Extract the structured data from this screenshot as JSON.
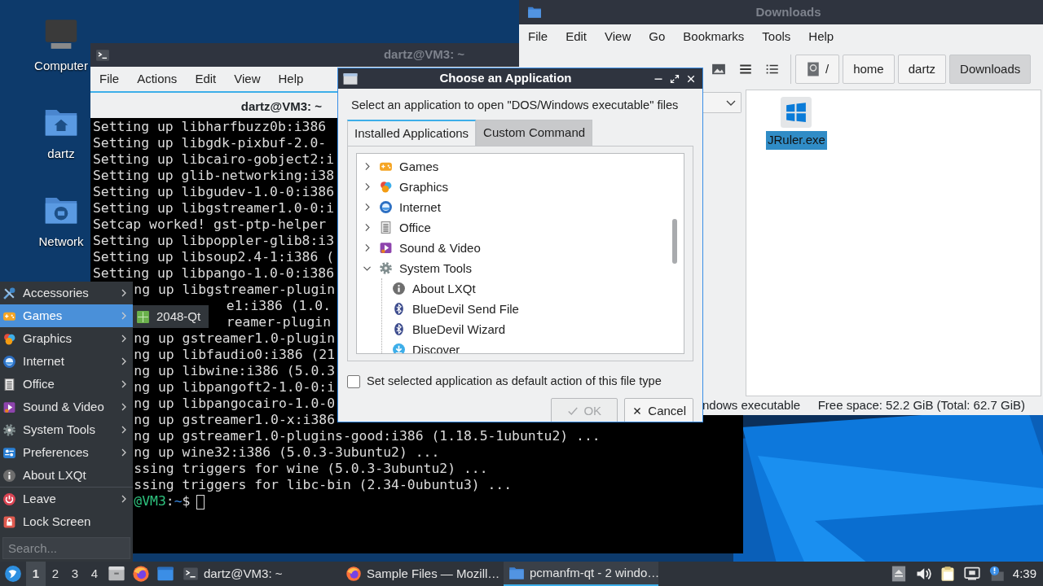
{
  "desktop_icons": [
    {
      "label": "Computer",
      "kind": "computer"
    },
    {
      "label": "dartz",
      "kind": "home"
    },
    {
      "label": "Network",
      "kind": "network"
    }
  ],
  "terminal": {
    "title": "dartz@VM3: ~",
    "menu": [
      "File",
      "Actions",
      "Edit",
      "View",
      "Help"
    ],
    "tab": "dartz@VM3: ~",
    "lines": [
      {
        "text": "Setting up libharfbuzz0b:i386",
        "kind": "line"
      },
      {
        "text": "Setting up libgdk-pixbuf-2.0-",
        "kind": "line"
      },
      {
        "text": "Setting up libcairo-gobject2:i",
        "kind": "line"
      },
      {
        "text": "Setting up glib-networking:i38",
        "kind": "line"
      },
      {
        "text": "Setting up libgudev-1.0-0:i386",
        "kind": "line"
      },
      {
        "text": "Setting up libgstreamer1.0-0:i",
        "kind": "line"
      },
      {
        "text": "Setcap worked! gst-ptp-helper",
        "kind": "line"
      },
      {
        "text": "Setting up libpoppler-glib8:i3",
        "kind": "line"
      },
      {
        "text": "Setting up libsoup2.4-1:i386 (",
        "kind": "line"
      },
      {
        "text": "Setting up libpango-1.0-0:i386",
        "kind": "line"
      },
      {
        "text": "ng up libgstreamer-plugin",
        "kind": "after-menu"
      },
      {
        "text": "e1:i386 (1.0.",
        "kind": "after-submenu"
      },
      {
        "text": "reamer-plugin",
        "kind": "after-submenu"
      },
      {
        "text": "ng up gstreamer1.0-plugin",
        "kind": "after-menu"
      },
      {
        "text": "ng up libfaudio0:i386 (21",
        "kind": "after-menu"
      },
      {
        "text": "ng up libwine:i386 (5.0.3",
        "kind": "after-menu"
      },
      {
        "text": "ng up libpangoft2-1.0-0:i",
        "kind": "after-menu"
      },
      {
        "text": "ng up libpangocairo-1.0-0",
        "kind": "after-menu"
      },
      {
        "text": "ng up gstreamer1.0-x:i386",
        "kind": "after-menu"
      },
      {
        "text": "ng up gstreamer1.0-plugins-good:i386 (1.18.5-1ubuntu2) ...",
        "kind": "after-menu"
      },
      {
        "text": "ng up wine32:i386 (5.0.3-3ubuntu2) ...",
        "kind": "after-menu"
      },
      {
        "text": "ssing triggers for wine (5.0.3-3ubuntu2) ...",
        "kind": "after-menu"
      },
      {
        "text": "ssing triggers for libc-bin (2.34-0ubuntu3) ...",
        "kind": "after-menu"
      }
    ],
    "prompt": [
      {
        "text": "@VM3",
        "kind": "host"
      },
      {
        "text": ":",
        "kind": "plain"
      },
      {
        "text": "~",
        "kind": "path"
      },
      {
        "text": "$",
        "kind": "plain"
      }
    ]
  },
  "file_manager": {
    "title": "Downloads",
    "menu": [
      "File",
      "Edit",
      "View",
      "Go",
      "Bookmarks",
      "Tools",
      "Help"
    ],
    "path": [
      {
        "label": "/",
        "kind": "root",
        "selected": false
      },
      {
        "label": "home",
        "kind": "dir",
        "selected": false
      },
      {
        "label": "dartz",
        "kind": "dir",
        "selected": false
      },
      {
        "label": "Downloads",
        "kind": "dir",
        "selected": true
      }
    ],
    "files": [
      {
        "name": "JRuler.exe",
        "selected": true
      }
    ],
    "status": [
      "ndows executable",
      "Free space: 52.2 GiB (Total: 62.7 GiB)"
    ]
  },
  "dialog": {
    "title": "Choose an Application",
    "prompt": "Select an application to open \"DOS/Windows executable\" files",
    "tabs": [
      {
        "label": "Installed Applications",
        "selected": true
      },
      {
        "label": "Custom Command",
        "selected": false
      }
    ],
    "tree": [
      {
        "label": "Games",
        "kind": "games",
        "expanded": false
      },
      {
        "label": "Graphics",
        "kind": "graphics",
        "expanded": false
      },
      {
        "label": "Internet",
        "kind": "internet",
        "expanded": false
      },
      {
        "label": "Office",
        "kind": "office",
        "expanded": false
      },
      {
        "label": "Sound & Video",
        "kind": "sound-video",
        "expanded": false
      },
      {
        "label": "System Tools",
        "kind": "system",
        "expanded": true,
        "children": [
          {
            "label": "About LXQt",
            "kind": "info"
          },
          {
            "label": "BlueDevil Send File",
            "kind": "bluetooth"
          },
          {
            "label": "BlueDevil Wizard",
            "kind": "bluetooth"
          },
          {
            "label": "Discover",
            "kind": "discover"
          }
        ]
      }
    ],
    "checkbox": {
      "label": "Set selected application as default action of this file type",
      "checked": false
    },
    "buttons": [
      {
        "label": "OK",
        "kind": "ok",
        "disabled": true
      },
      {
        "label": "Cancel",
        "kind": "cancel",
        "disabled": false
      }
    ]
  },
  "app_menu": {
    "items": [
      {
        "label": "Accessories",
        "kind": "accessories",
        "submenu": true,
        "selected": false
      },
      {
        "label": "Games",
        "kind": "games",
        "submenu": true,
        "selected": true
      },
      {
        "label": "Graphics",
        "kind": "graphics",
        "submenu": true,
        "selected": false
      },
      {
        "label": "Internet",
        "kind": "internet",
        "submenu": true,
        "selected": false
      },
      {
        "label": "Office",
        "kind": "office",
        "submenu": true,
        "selected": false
      },
      {
        "label": "Sound & Video",
        "kind": "sound-video",
        "submenu": true,
        "selected": false
      },
      {
        "label": "System Tools",
        "kind": "system",
        "submenu": true,
        "selected": false
      },
      {
        "label": "Preferences",
        "kind": "preferences",
        "submenu": true,
        "selected": false
      },
      {
        "label": "About LXQt",
        "kind": "info",
        "submenu": false,
        "selected": false
      },
      {
        "kind": "separator"
      },
      {
        "label": "Leave",
        "kind": "leave",
        "submenu": true,
        "selected": false
      },
      {
        "label": "Lock Screen",
        "kind": "lock",
        "submenu": false,
        "selected": false
      }
    ],
    "submenu": [
      "2048-Qt"
    ],
    "search": {
      "placeholder": "Search..."
    }
  },
  "taskbar": {
    "workspaces": [
      {
        "label": "1",
        "selected": true
      },
      {
        "label": "2",
        "selected": false
      },
      {
        "label": "3",
        "selected": false
      },
      {
        "label": "4",
        "selected": false
      }
    ],
    "tasks": [
      {
        "label": "dartz@VM3: ~",
        "kind": "terminal",
        "selected": false
      },
      {
        "label": "Sample Files — Mozill…",
        "kind": "browser",
        "selected": false
      },
      {
        "label": "pcmanfm-qt - 2 windo…",
        "kind": "folder",
        "selected": true
      }
    ],
    "clock": "4:39"
  }
}
